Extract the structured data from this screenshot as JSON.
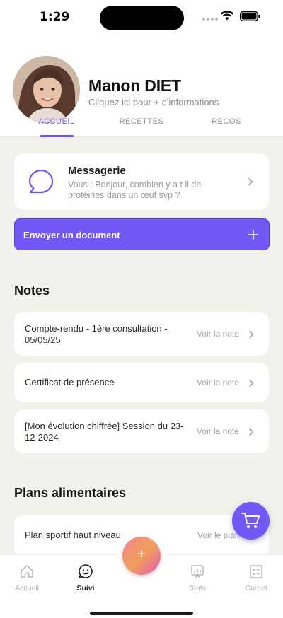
{
  "status_bar": {
    "time": "1:29"
  },
  "profile": {
    "name": "Manon DIET",
    "subtitle": "Cliquez ici pour + d'informations"
  },
  "tabs": [
    {
      "label": "ACCUEIL",
      "active": true
    },
    {
      "label": "RECETTES",
      "active": false
    },
    {
      "label": "RECOS",
      "active": false
    }
  ],
  "messaging": {
    "title": "Messagerie",
    "preview": "Vous : Bonjour, combien y a t il de protéines dans un œuf svp ?"
  },
  "upload": {
    "label": "Envoyer un document"
  },
  "notes": {
    "title": "Notes",
    "items": [
      {
        "text": "Compte-rendu - 1ère consultation - 05/05/25",
        "link": "Voir la note"
      },
      {
        "text": "Certificat de présence",
        "link": "Voir la note"
      },
      {
        "text": "[Mon évolution chiffrée] Session du 23-12-2024",
        "link": "Voir la note"
      }
    ]
  },
  "plans": {
    "title": "Plans alimentaires",
    "items": [
      {
        "text": "Plan sportif haut niveau",
        "link": "Voir le plan"
      }
    ]
  },
  "bottom_nav": {
    "items": [
      {
        "label": "Accueil",
        "icon": "home-icon",
        "active": false
      },
      {
        "label": "Suivi",
        "icon": "smiley-icon",
        "active": true
      },
      {
        "label": "Stats",
        "icon": "stats-icon",
        "active": false
      },
      {
        "label": "Carnet",
        "icon": "carnet-icon",
        "active": false
      }
    ],
    "center_button": "+"
  },
  "colors": {
    "accent": "#7358f5",
    "background": "#f3f1ec"
  }
}
